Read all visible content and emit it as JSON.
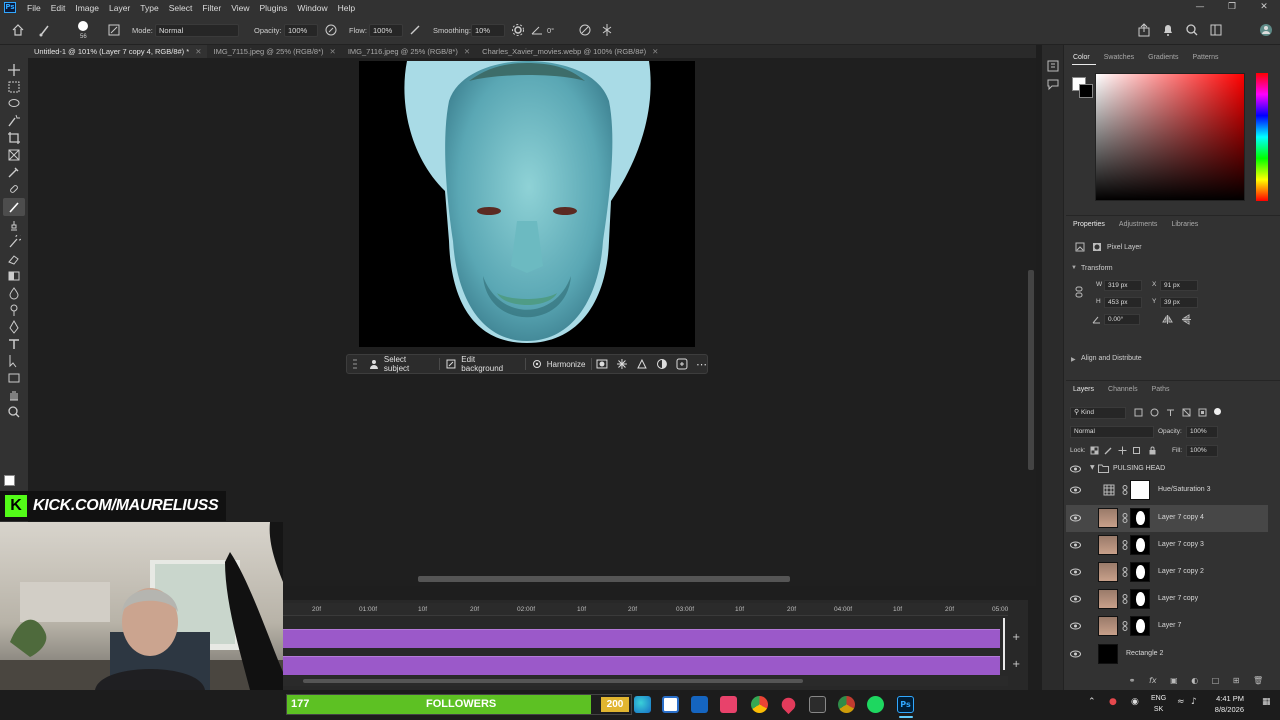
{
  "menubar": {
    "items": [
      "File",
      "Edit",
      "Image",
      "Layer",
      "Type",
      "Select",
      "Filter",
      "View",
      "Plugins",
      "Window",
      "Help"
    ]
  },
  "options": {
    "brush_size": "56",
    "mode_label": "Mode:",
    "mode_value": "Normal",
    "opacity_label": "Opacity:",
    "opacity_value": "100%",
    "flow_label": "Flow:",
    "flow_value": "100%",
    "smoothing_label": "Smoothing:",
    "smoothing_value": "10%",
    "angle_value": "0°"
  },
  "tabs": [
    {
      "label": "Untitled-1 @ 101% (Layer 7 copy 4, RGB/8#) *",
      "active": true
    },
    {
      "label": "IMG_7115.jpeg @ 25% (RGB/8*)",
      "active": false
    },
    {
      "label": "IMG_7116.jpeg @ 25% (RGB/8*)",
      "active": false
    },
    {
      "label": "Charles_Xavier_movies.webp @ 100% (RGB/8#)",
      "active": false
    }
  ],
  "context_bar": {
    "select_subject": "Select subject",
    "edit_background": "Edit background",
    "harmonize": "Harmonize"
  },
  "color_panel": {
    "tabs": [
      "Color",
      "Swatches",
      "Gradients",
      "Patterns"
    ],
    "active_tab": "Color"
  },
  "properties": {
    "tabs": [
      "Properties",
      "Adjustments",
      "Libraries"
    ],
    "layer_type": "Pixel Layer",
    "transform_label": "Transform",
    "w_label": "W",
    "w_value": "319 px",
    "h_label": "H",
    "h_value": "453 px",
    "x_label": "X",
    "x_value": "91 px",
    "y_label": "Y",
    "y_value": "39 px",
    "angle_value": "0.00°",
    "align_label": "Align and Distribute"
  },
  "layers_panel": {
    "tabs": [
      "Layers",
      "Channels",
      "Paths"
    ],
    "kind_label": "Kind",
    "blend_mode": "Normal",
    "opacity_label": "Opacity:",
    "opacity_value": "100%",
    "lock_label": "Lock:",
    "fill_label": "Fill:",
    "fill_value": "100%",
    "group_name": "PULSING HEAD",
    "layers": [
      {
        "name": "Hue/Saturation 3"
      },
      {
        "name": "Layer 7 copy 4"
      },
      {
        "name": "Layer 7 copy 3"
      },
      {
        "name": "Layer 7 copy 2"
      },
      {
        "name": "Layer 7 copy"
      },
      {
        "name": "Layer 7"
      },
      {
        "name": "Rectangle 2"
      }
    ]
  },
  "timeline": {
    "ticks": [
      "20f",
      "01:00f",
      "10f",
      "20f",
      "02:00f",
      "10f",
      "20f",
      "03:00f",
      "10f",
      "20f",
      "04:00f",
      "10f",
      "20f",
      "05:00"
    ]
  },
  "overlay": {
    "kick_url": "KICK.COM/MAURELIUSS",
    "followers_count": "177",
    "followers_label": "FOLLOWERS",
    "followers_goal": "200",
    "followers_progress": 0.885
  },
  "taskbar": {
    "lang_top": "ENG",
    "lang_bottom": "SK",
    "time": "4:41 PM",
    "date": "8/8/2026"
  }
}
